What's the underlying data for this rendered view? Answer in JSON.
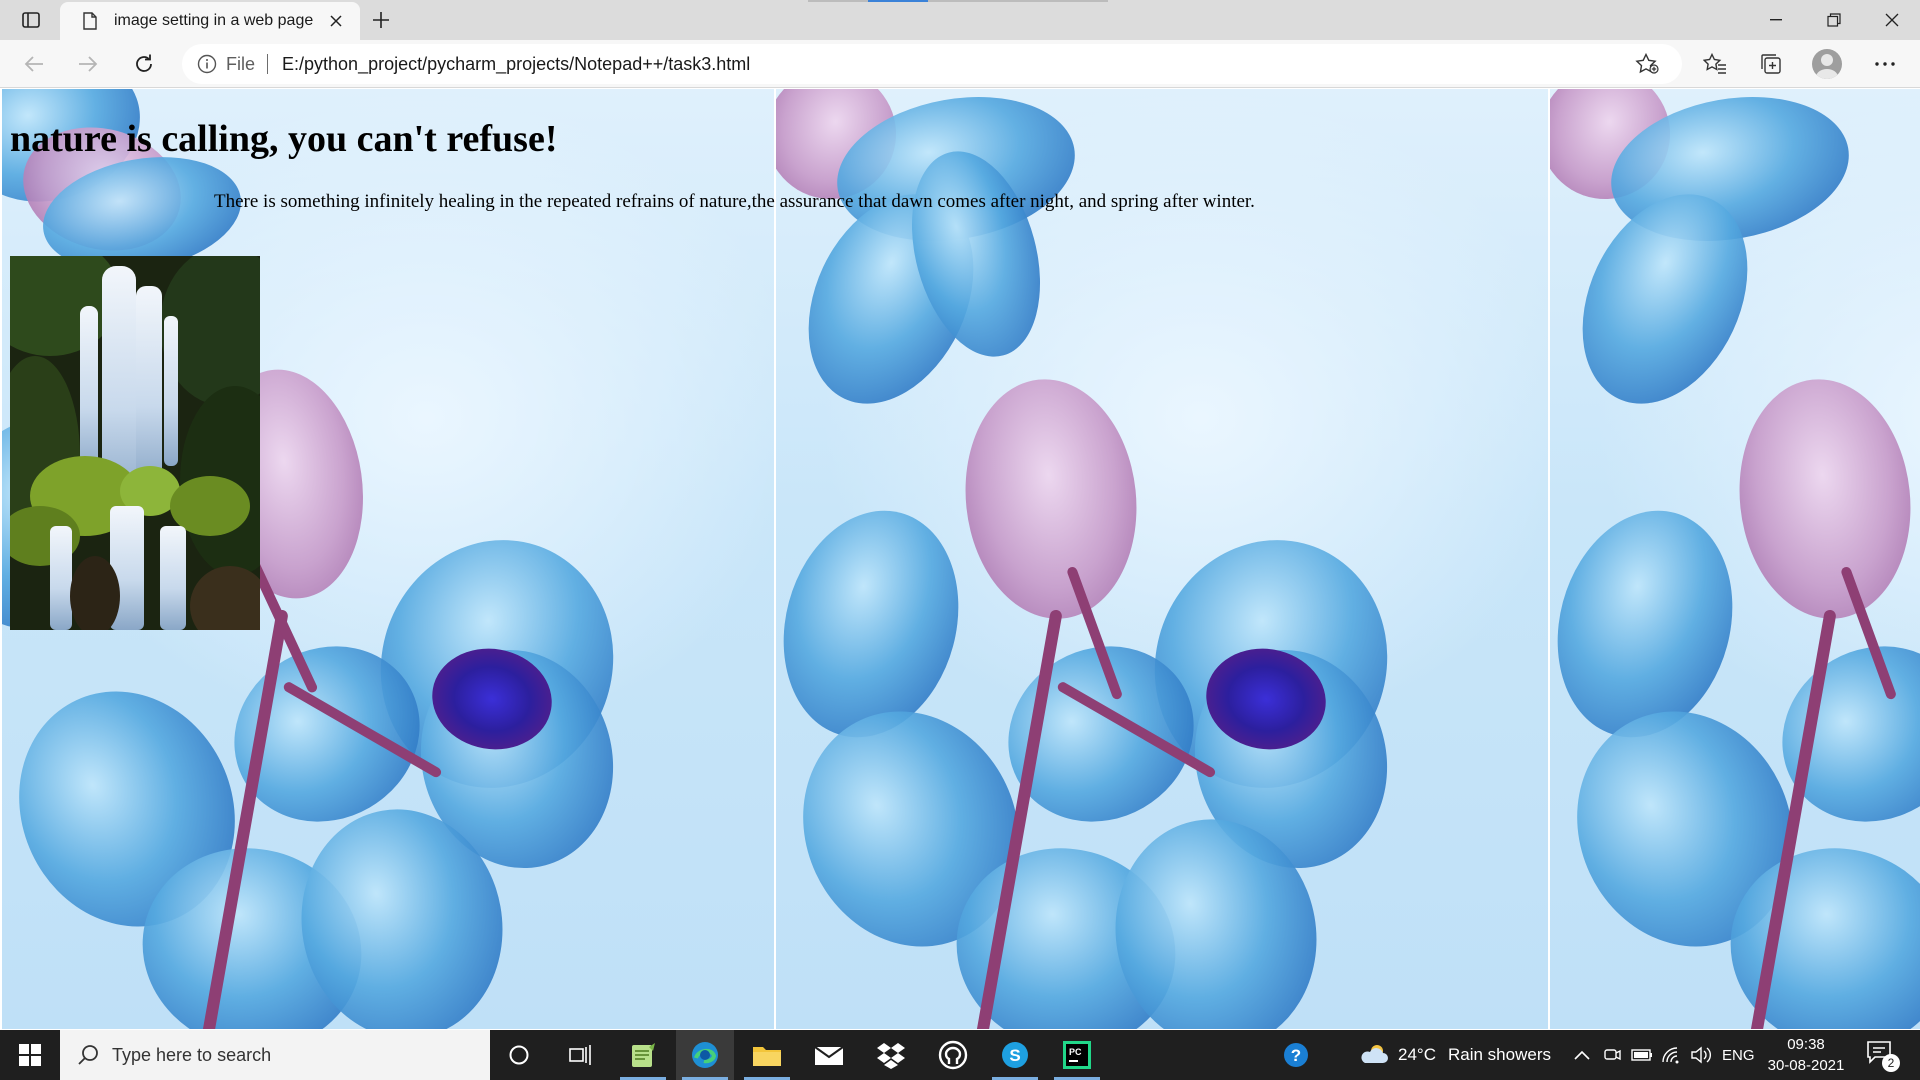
{
  "browser": {
    "tab": {
      "title": "image setting in a web page",
      "icon": "page-icon"
    },
    "address_bar": {
      "scheme_label": "File",
      "url": "E:/python_project/pycharm_projects/Notepad++/task3.html"
    }
  },
  "page": {
    "heading": "nature is calling, you can't refuse!",
    "paragraph": "There is something infinitely healing in the repeated refrains of nature,the assurance that dawn comes after night, and spring after winter.",
    "image": {
      "subject": "waterfall-photo"
    },
    "background": {
      "subject": "blue-orchid-tiled-background"
    }
  },
  "taskbar": {
    "search_placeholder": "Type here to search",
    "apps": [
      "cortana-icon",
      "task-view-icon",
      "notepad-plus-plus-icon",
      "edge-icon",
      "file-explorer-icon",
      "mail-icon",
      "dropbox-icon",
      "github-icon",
      "skype-icon",
      "pycharm-icon"
    ],
    "weather": {
      "temperature": "24°C",
      "condition": "Rain showers"
    },
    "language": "ENG",
    "time": "09:38",
    "date": "30-08-2021",
    "notification_count": "2"
  },
  "colors": {
    "taskbar": "#1f1f1f",
    "tabstrip": "#dcdcdc",
    "toolbar": "#f7f7f7",
    "orchid_blue": "#2a72c1",
    "orchid_stem": "#8e3f74"
  }
}
